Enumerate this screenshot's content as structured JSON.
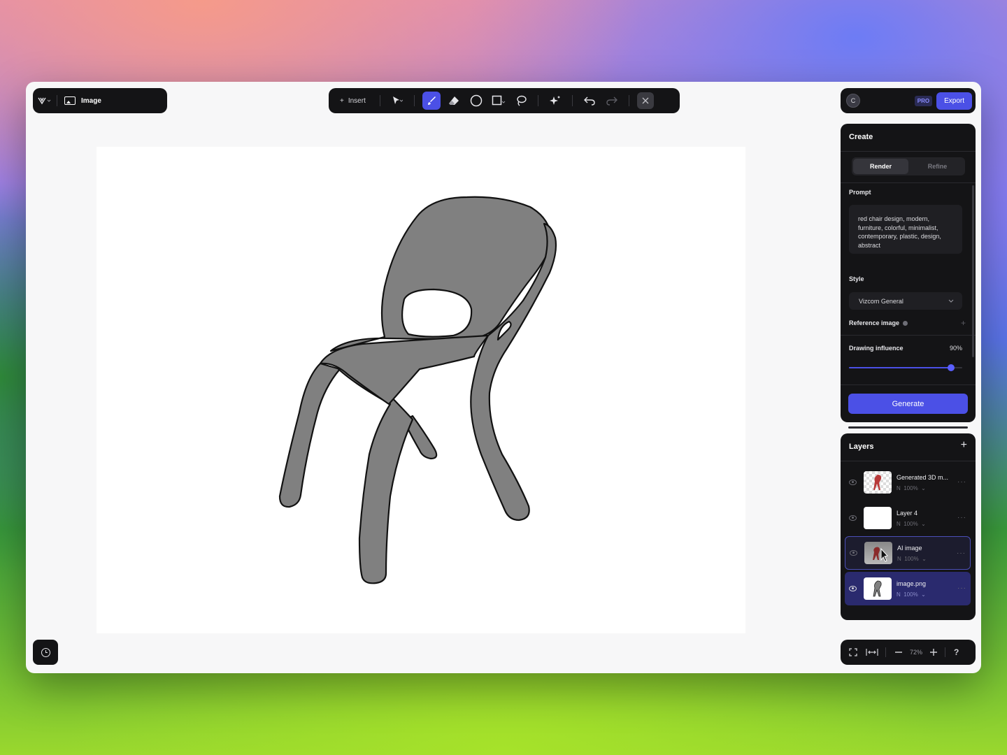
{
  "file": {
    "name": "Image"
  },
  "toolbar": {
    "insert_label": "Insert",
    "tools": [
      "select-icon",
      "brush-icon",
      "eraser-icon",
      "ellipse-icon",
      "rectangle-icon",
      "lasso-icon",
      "magic-icon",
      "undo-icon",
      "redo-icon",
      "close-icon"
    ],
    "active_tool": "brush-icon"
  },
  "account": {
    "avatar_initial": "C",
    "pro_label": "PRO",
    "export_label": "Export"
  },
  "create_panel": {
    "title": "Create",
    "tabs": [
      "Render",
      "Refine"
    ],
    "active_tab": "Render",
    "prompt_label": "Prompt",
    "prompt_text": "red chair design, modern, furniture, colorful, minimalist, contemporary, plastic, design, abstract",
    "style_label": "Style",
    "style_value": "Vizcom General",
    "reference_label": "Reference image",
    "influence_label": "Drawing influence",
    "influence_value": "90%",
    "influence_fraction": 0.9,
    "generate_label": "Generate"
  },
  "layers_panel": {
    "title": "Layers",
    "layers": [
      {
        "name": "Generated 3D m...",
        "mode": "N",
        "opacity": "100%",
        "visible": false
      },
      {
        "name": "Layer 4",
        "mode": "N",
        "opacity": "100%",
        "visible": false
      },
      {
        "name": "AI image",
        "mode": "N",
        "opacity": "100%",
        "visible": false
      },
      {
        "name": "image.png",
        "mode": "N",
        "opacity": "100%",
        "visible": true
      }
    ]
  },
  "zoom": {
    "value": "72%",
    "help": "?"
  },
  "colors": {
    "accent": "#4b50e6",
    "panel": "#141416",
    "chair_fill": "#808080"
  }
}
